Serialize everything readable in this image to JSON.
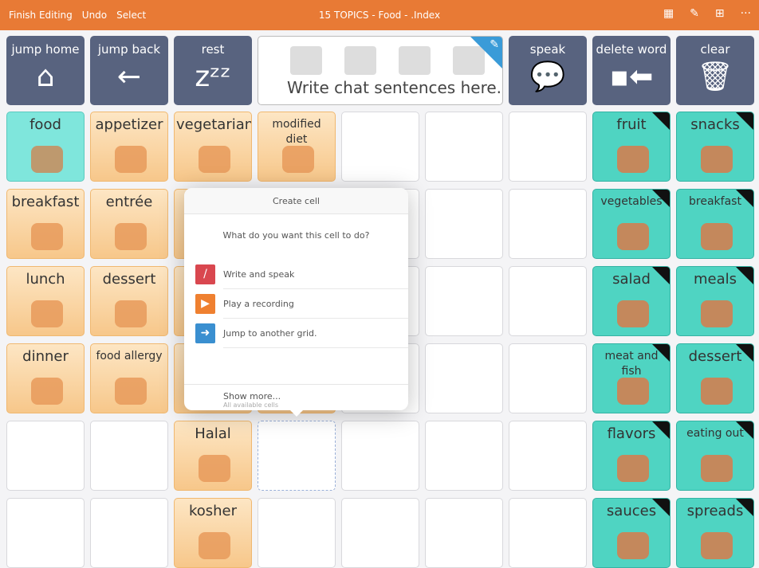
{
  "topbar": {
    "finish": "Finish Editing",
    "undo": "Undo",
    "select": "Select",
    "title": "15 TOPICS - Food - .Index",
    "icons": [
      "table-icon",
      "pen-icon",
      "grid-icon",
      "more-icon"
    ]
  },
  "nav": [
    {
      "label": "jump home",
      "icon": "⌂",
      "name": "jump-home"
    },
    {
      "label": "jump back",
      "icon": "←",
      "name": "jump-back"
    },
    {
      "label": "rest",
      "icon": "zᶻᶻ",
      "name": "rest"
    },
    {
      "label": "speak",
      "icon": "💬",
      "name": "speak"
    },
    {
      "label": "delete word",
      "icon": "▪⬅",
      "name": "delete-word"
    },
    {
      "label": "clear",
      "icon": "🗑",
      "name": "clear"
    }
  ],
  "message_bar": {
    "text": "Write chat sentences here."
  },
  "grid": [
    [
      {
        "l": "food",
        "c": "cyan"
      },
      {
        "l": "appetizer",
        "c": "orange"
      },
      {
        "l": "vegetarian",
        "c": "orange"
      },
      {
        "l": "modified diet",
        "c": "orange",
        "s": 1
      },
      {
        "c": "empty"
      },
      {
        "c": "empty"
      },
      {
        "c": "empty"
      },
      {
        "l": "fruit",
        "c": "teal"
      },
      {
        "l": "snacks",
        "c": "teal"
      }
    ],
    [
      {
        "l": "breakfast",
        "c": "orange"
      },
      {
        "l": "entrée",
        "c": "orange"
      },
      {
        "c": "orange"
      },
      {
        "c": "empty"
      },
      {
        "c": "empty"
      },
      {
        "c": "empty"
      },
      {
        "c": "empty"
      },
      {
        "l": "vegetables",
        "c": "teal",
        "s": 1
      },
      {
        "l": "breakfast",
        "c": "teal",
        "s": 1
      }
    ],
    [
      {
        "l": "lunch",
        "c": "orange"
      },
      {
        "l": "dessert",
        "c": "orange"
      },
      {
        "c": "orange"
      },
      {
        "c": "empty"
      },
      {
        "c": "empty"
      },
      {
        "c": "empty"
      },
      {
        "c": "empty"
      },
      {
        "l": "salad",
        "c": "teal"
      },
      {
        "l": "meals",
        "c": "teal"
      }
    ],
    [
      {
        "l": "dinner",
        "c": "orange"
      },
      {
        "l": "food allergy",
        "c": "orange",
        "s": 1
      },
      {
        "c": "orange"
      },
      {
        "c": "orange"
      },
      {
        "c": "empty"
      },
      {
        "c": "empty"
      },
      {
        "c": "empty"
      },
      {
        "l": "meat and fish",
        "c": "teal",
        "s": 1
      },
      {
        "l": "dessert",
        "c": "teal"
      }
    ],
    [
      {
        "c": "empty"
      },
      {
        "c": "empty"
      },
      {
        "l": "Halal",
        "c": "orange"
      },
      {
        "c": "selected"
      },
      {
        "c": "empty"
      },
      {
        "c": "empty"
      },
      {
        "c": "empty"
      },
      {
        "l": "flavors",
        "c": "teal"
      },
      {
        "l": "eating out",
        "c": "teal",
        "s": 1
      }
    ],
    [
      {
        "c": "empty"
      },
      {
        "c": "empty"
      },
      {
        "l": "kosher",
        "c": "orange"
      },
      {
        "c": "empty"
      },
      {
        "c": "empty"
      },
      {
        "c": "empty"
      },
      {
        "c": "empty"
      },
      {
        "l": "sauces",
        "c": "teal"
      },
      {
        "l": "spreads",
        "c": "teal"
      }
    ]
  ],
  "popup": {
    "title": "Create cell",
    "question": "What do you want this cell to do?",
    "options": [
      {
        "label": "Write and speak",
        "color": "#d9474f",
        "icon": "/"
      },
      {
        "label": "Play a recording",
        "color": "#ef8030",
        "icon": "▶"
      },
      {
        "label": "Jump to another grid.",
        "color": "#3a8fd0",
        "icon": "➜"
      }
    ],
    "more": "Show more...",
    "more_sub": "All available cells"
  }
}
